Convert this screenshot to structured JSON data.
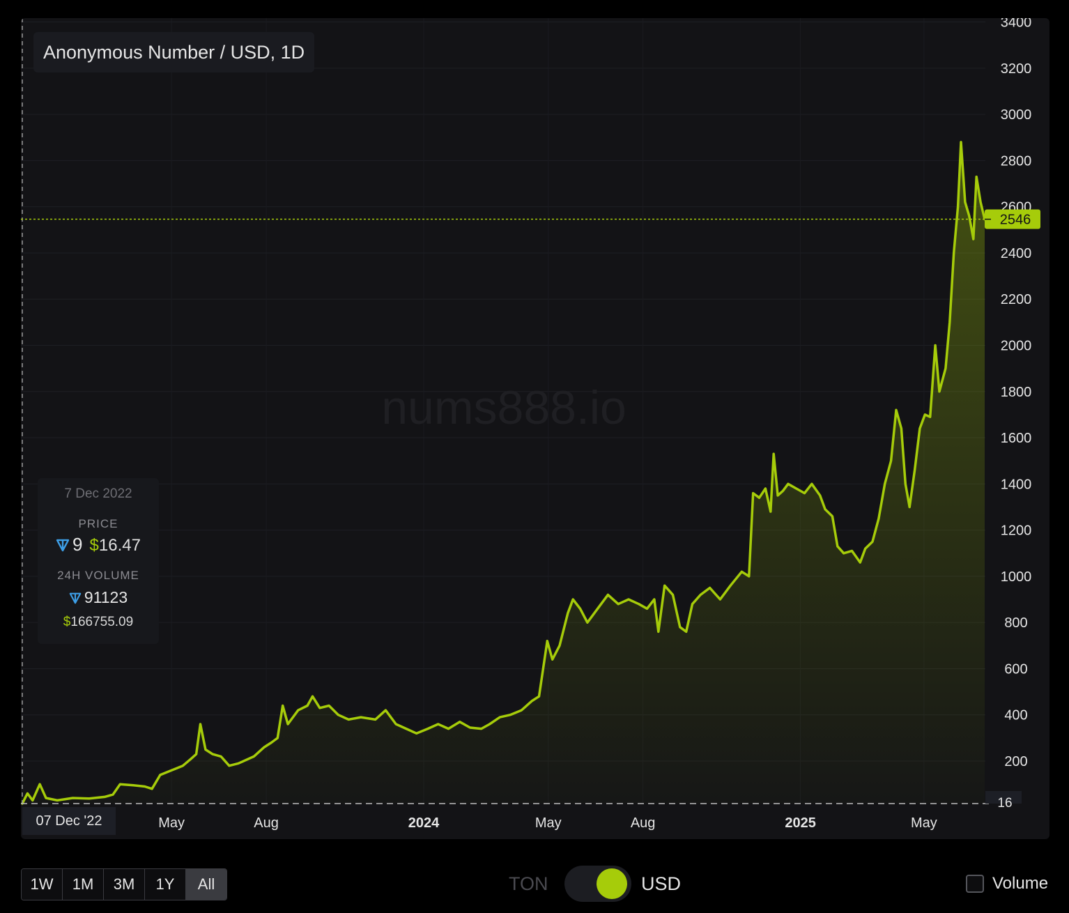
{
  "chart_title": "Anonymous Number / USD, 1D",
  "watermark": "nums888.io",
  "info": {
    "date": "7 Dec 2022",
    "price_label": "PRICE",
    "price_ton": "9",
    "price_usd_symbol": "$",
    "price_usd": "16.47",
    "volume_label": "24H VOLUME",
    "volume_ton": "91123",
    "volume_usd_symbol": "$",
    "volume_usd": "166755.09"
  },
  "start_date_label": "07 Dec '22",
  "last_price_label": "2546",
  "min_label": "16",
  "controls": {
    "ranges": [
      "1W",
      "1M",
      "3M",
      "1Y",
      "All"
    ],
    "active_range": "All",
    "toggle_off_label": "TON",
    "toggle_on_label": "USD",
    "volume_label": "Volume"
  },
  "colors": {
    "line": "#a6cc0a",
    "last_price_badge": "#a6cc0a",
    "background": "#131316",
    "ton_icon": "#3d9ee6"
  },
  "chart_data": {
    "type": "area",
    "title": "Anonymous Number / USD, 1D",
    "xlabel": "",
    "ylabel": "",
    "ylim": [
      16,
      3400
    ],
    "yticks": [
      200,
      400,
      600,
      800,
      1000,
      1200,
      1400,
      1600,
      1800,
      2000,
      2200,
      2400,
      2600,
      2800,
      3000,
      3200,
      3400
    ],
    "xticks": [
      {
        "date": "2023-05-01",
        "label": "May",
        "bold": false
      },
      {
        "date": "2023-08-01",
        "label": "Aug",
        "bold": false
      },
      {
        "date": "2024-01-01",
        "label": "2024",
        "bold": true
      },
      {
        "date": "2024-05-01",
        "label": "May",
        "bold": false
      },
      {
        "date": "2024-08-01",
        "label": "Aug",
        "bold": false
      },
      {
        "date": "2025-01-01",
        "label": "2025",
        "bold": true
      },
      {
        "date": "2025-05-01",
        "label": "May",
        "bold": false
      }
    ],
    "last_value": 2546,
    "grid": true,
    "series": [
      {
        "points": [
          [
            "2022-12-07",
            16
          ],
          [
            "2022-12-12",
            60
          ],
          [
            "2022-12-17",
            30
          ],
          [
            "2022-12-24",
            100
          ],
          [
            "2022-12-30",
            40
          ],
          [
            "2023-01-10",
            30
          ],
          [
            "2023-01-25",
            40
          ],
          [
            "2023-02-10",
            38
          ],
          [
            "2023-02-25",
            45
          ],
          [
            "2023-03-05",
            55
          ],
          [
            "2023-03-12",
            100
          ],
          [
            "2023-03-25",
            95
          ],
          [
            "2023-04-05",
            90
          ],
          [
            "2023-04-12",
            80
          ],
          [
            "2023-04-20",
            140
          ],
          [
            "2023-05-01",
            160
          ],
          [
            "2023-05-12",
            180
          ],
          [
            "2023-05-20",
            210
          ],
          [
            "2023-05-25",
            230
          ],
          [
            "2023-05-29",
            360
          ],
          [
            "2023-06-03",
            250
          ],
          [
            "2023-06-10",
            230
          ],
          [
            "2023-06-18",
            220
          ],
          [
            "2023-06-26",
            180
          ],
          [
            "2023-07-05",
            190
          ],
          [
            "2023-07-20",
            220
          ],
          [
            "2023-07-30",
            260
          ],
          [
            "2023-08-06",
            280
          ],
          [
            "2023-08-12",
            300
          ],
          [
            "2023-08-17",
            440
          ],
          [
            "2023-08-22",
            360
          ],
          [
            "2023-09-01",
            420
          ],
          [
            "2023-09-10",
            440
          ],
          [
            "2023-09-15",
            480
          ],
          [
            "2023-09-22",
            430
          ],
          [
            "2023-10-01",
            440
          ],
          [
            "2023-10-10",
            400
          ],
          [
            "2023-10-20",
            380
          ],
          [
            "2023-11-01",
            390
          ],
          [
            "2023-11-15",
            380
          ],
          [
            "2023-11-25",
            420
          ],
          [
            "2023-12-05",
            360
          ],
          [
            "2023-12-15",
            340
          ],
          [
            "2023-12-25",
            320
          ],
          [
            "2024-01-05",
            340
          ],
          [
            "2024-01-15",
            360
          ],
          [
            "2024-01-25",
            340
          ],
          [
            "2024-02-05",
            370
          ],
          [
            "2024-02-15",
            345
          ],
          [
            "2024-02-26",
            340
          ],
          [
            "2024-03-05",
            360
          ],
          [
            "2024-03-15",
            390
          ],
          [
            "2024-03-25",
            400
          ],
          [
            "2024-04-05",
            420
          ],
          [
            "2024-04-15",
            460
          ],
          [
            "2024-04-22",
            480
          ],
          [
            "2024-04-26",
            600
          ],
          [
            "2024-04-30",
            720
          ],
          [
            "2024-05-05",
            640
          ],
          [
            "2024-05-12",
            700
          ],
          [
            "2024-05-20",
            840
          ],
          [
            "2024-05-25",
            900
          ],
          [
            "2024-06-01",
            860
          ],
          [
            "2024-06-08",
            800
          ],
          [
            "2024-06-18",
            860
          ],
          [
            "2024-06-28",
            920
          ],
          [
            "2024-07-08",
            880
          ],
          [
            "2024-07-18",
            900
          ],
          [
            "2024-07-28",
            880
          ],
          [
            "2024-08-05",
            860
          ],
          [
            "2024-08-12",
            900
          ],
          [
            "2024-08-16",
            760
          ],
          [
            "2024-08-22",
            960
          ],
          [
            "2024-08-30",
            920
          ],
          [
            "2024-09-06",
            780
          ],
          [
            "2024-09-12",
            760
          ],
          [
            "2024-09-18",
            880
          ],
          [
            "2024-09-26",
            920
          ],
          [
            "2024-10-05",
            950
          ],
          [
            "2024-10-15",
            900
          ],
          [
            "2024-10-25",
            960
          ],
          [
            "2024-11-05",
            1020
          ],
          [
            "2024-11-12",
            1000
          ],
          [
            "2024-11-16",
            1360
          ],
          [
            "2024-11-22",
            1340
          ],
          [
            "2024-11-28",
            1380
          ],
          [
            "2024-12-03",
            1280
          ],
          [
            "2024-12-06",
            1530
          ],
          [
            "2024-12-10",
            1350
          ],
          [
            "2024-12-15",
            1370
          ],
          [
            "2024-12-20",
            1400
          ],
          [
            "2024-12-28",
            1380
          ],
          [
            "2025-01-05",
            1360
          ],
          [
            "2025-01-12",
            1400
          ],
          [
            "2025-01-20",
            1350
          ],
          [
            "2025-01-25",
            1290
          ],
          [
            "2025-02-01",
            1260
          ],
          [
            "2025-02-06",
            1130
          ],
          [
            "2025-02-12",
            1100
          ],
          [
            "2025-02-20",
            1110
          ],
          [
            "2025-02-28",
            1060
          ],
          [
            "2025-03-05",
            1120
          ],
          [
            "2025-03-12",
            1150
          ],
          [
            "2025-03-18",
            1250
          ],
          [
            "2025-03-24",
            1400
          ],
          [
            "2025-03-30",
            1500
          ],
          [
            "2025-04-04",
            1720
          ],
          [
            "2025-04-09",
            1640
          ],
          [
            "2025-04-13",
            1400
          ],
          [
            "2025-04-17",
            1300
          ],
          [
            "2025-04-22",
            1460
          ],
          [
            "2025-04-27",
            1640
          ],
          [
            "2025-05-02",
            1700
          ],
          [
            "2025-05-07",
            1690
          ],
          [
            "2025-05-12",
            2000
          ],
          [
            "2025-05-16",
            1800
          ],
          [
            "2025-05-22",
            1900
          ],
          [
            "2025-05-26",
            2100
          ],
          [
            "2025-05-30",
            2400
          ],
          [
            "2025-06-03",
            2600
          ],
          [
            "2025-06-06",
            2880
          ],
          [
            "2025-06-10",
            2620
          ],
          [
            "2025-06-14",
            2560
          ],
          [
            "2025-06-18",
            2460
          ],
          [
            "2025-06-21",
            2730
          ],
          [
            "2025-06-25",
            2620
          ],
          [
            "2025-06-29",
            2546
          ]
        ]
      }
    ]
  }
}
